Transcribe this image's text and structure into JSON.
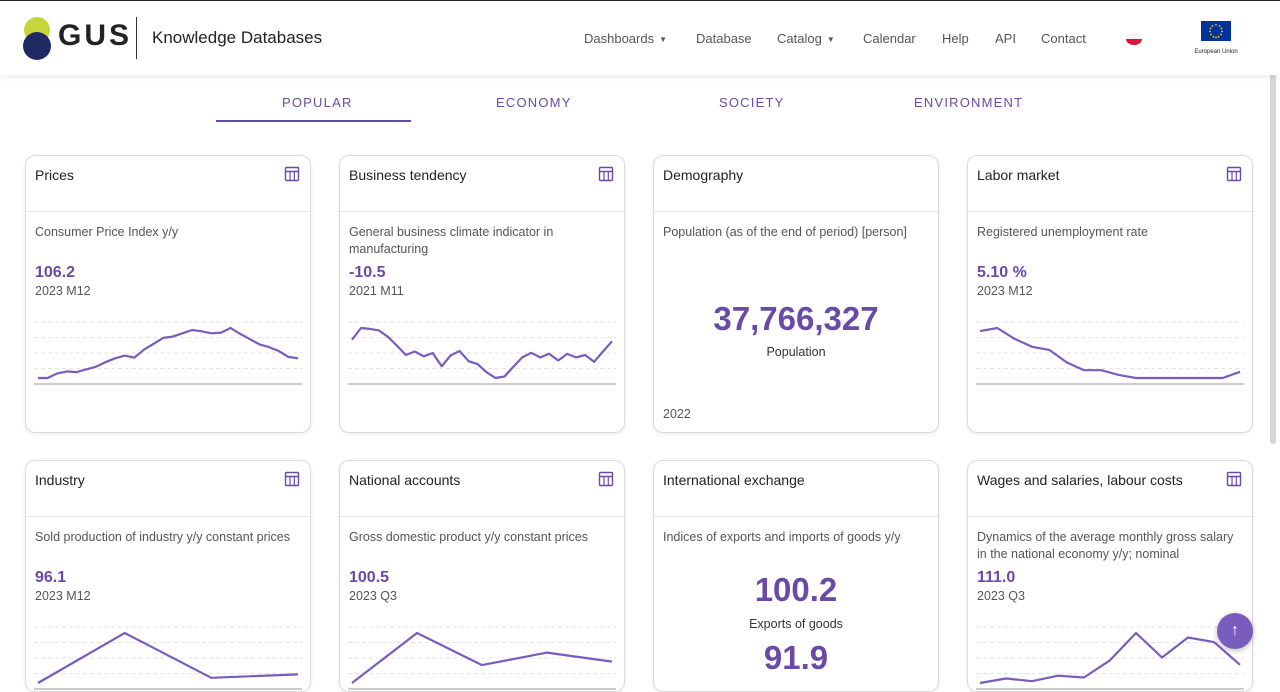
{
  "header": {
    "logo_text": "GUS",
    "site_title": "Knowledge Databases",
    "nav": [
      {
        "label": "Dashboards",
        "dropdown": true
      },
      {
        "label": "Database",
        "dropdown": false
      },
      {
        "label": "Catalog",
        "dropdown": true
      },
      {
        "label": "Calendar",
        "dropdown": false
      },
      {
        "label": "Help",
        "dropdown": false
      },
      {
        "label": "API",
        "dropdown": false
      },
      {
        "label": "Contact",
        "dropdown": false
      }
    ],
    "eu_label": "European Union"
  },
  "tabs": [
    "POPULAR",
    "ECONOMY",
    "SOCIETY",
    "ENVIRONMENT"
  ],
  "active_tab": "POPULAR",
  "colors": {
    "accent": "#6a4aa6",
    "line": "#7a5cbf"
  },
  "cards": [
    {
      "title": "Prices",
      "desc": "Consumer Price Index y/y",
      "value": "106.2",
      "period": "2023 M12",
      "series": [
        101.5,
        101.5,
        102.2,
        102.5,
        102.4,
        102.8,
        103.2,
        103.9,
        104.5,
        104.9,
        104.6,
        105.8,
        106.7,
        107.6,
        107.8,
        108.3,
        108.8,
        108.6,
        108.3,
        108.4,
        109.1,
        108.2,
        107.4,
        106.6,
        106.2,
        105.6,
        104.7,
        104.5
      ]
    },
    {
      "title": "Business tendency",
      "desc": "General business climate indicator in manufacturing",
      "value": "-10.5",
      "period": "2021 M11",
      "series": [
        -9.8,
        -4.5,
        -4.9,
        -5.6,
        -8.5,
        -12.4,
        -16.7,
        -15.1,
        -17.3,
        -15.8,
        -21.8,
        -16.9,
        -14.9,
        -19.5,
        -20.8,
        -24.5,
        -27.1,
        -26.4,
        -22.0,
        -17.7,
        -15.7,
        -17.8,
        -16.1,
        -19.2,
        -16.2,
        -17.8,
        -16.7,
        -19.8,
        -15.1,
        -10.5
      ]
    },
    {
      "title": "Demography",
      "desc": "Population (as of the end of period) [person]",
      "big_value": "37,766,327",
      "big_label": "Population",
      "year": "2022"
    },
    {
      "title": "Labor market",
      "desc": "Registered unemployment rate",
      "value": "5.10 %",
      "period": "2023 M12",
      "series": [
        5.4,
        5.42,
        5.35,
        5.3,
        5.28,
        5.2,
        5.15,
        5.15,
        5.12,
        5.1,
        5.1,
        5.1,
        5.1,
        5.1,
        5.1,
        5.14
      ]
    },
    {
      "title": "Industry",
      "desc": "Sold production of industry y/y constant prices",
      "value": "96.1",
      "period": "2023 M12",
      "series": [
        91,
        120,
        94,
        96
      ]
    },
    {
      "title": "National accounts",
      "desc": "Gross domestic product y/y constant prices",
      "value": "100.5",
      "period": "2023 Q3",
      "series": [
        90,
        104,
        95,
        98.5,
        96
      ]
    },
    {
      "title": "International exchange",
      "desc": "Indices of exports and imports of goods y/y",
      "big_value": "100.2",
      "big_label": "Exports of goods",
      "big_value2": "91.9"
    },
    {
      "title": "Wages and salaries, labour costs",
      "desc": "Dynamics of the average monthly gross salary in the national economy y/y; nominal",
      "value": "111.0",
      "period": "2023 Q3",
      "series": [
        104,
        104.5,
        104.2,
        104.8,
        104.6,
        106.5,
        109.5,
        106.8,
        109,
        108.5,
        106
      ]
    }
  ]
}
